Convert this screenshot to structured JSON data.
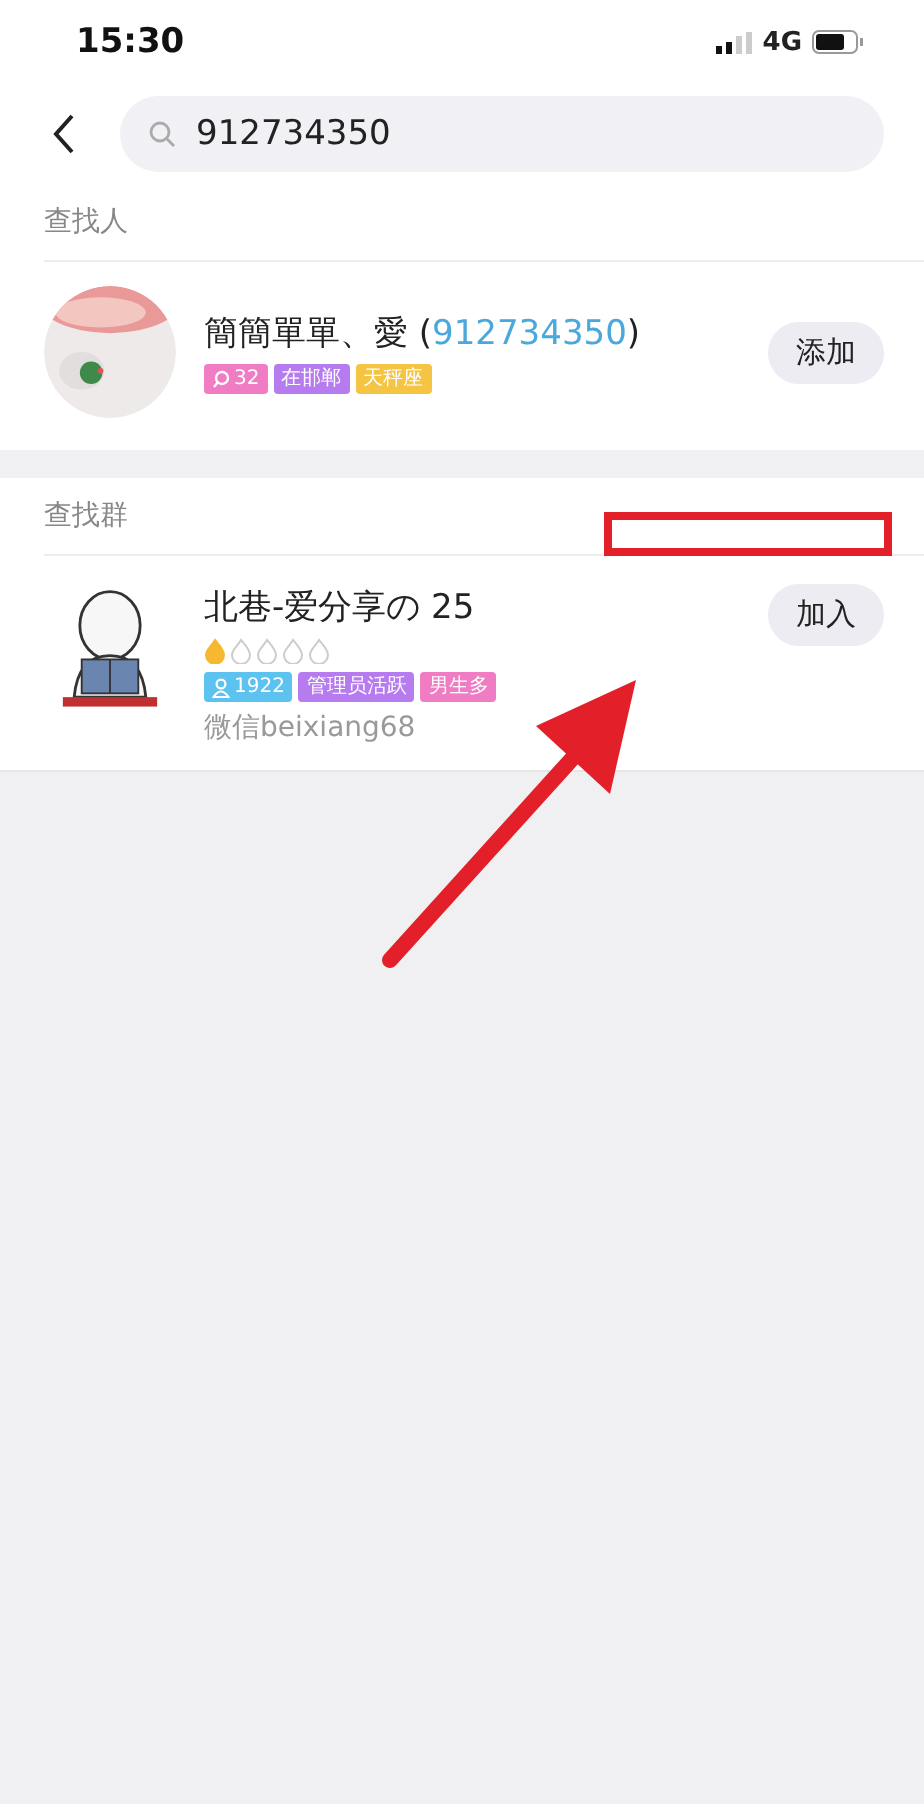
{
  "status_bar": {
    "time": "15:30",
    "network": "4G"
  },
  "search": {
    "value": "912734350"
  },
  "people_section": {
    "title": "查找人",
    "results": [
      {
        "name": "簡簡單單、愛 (",
        "id": "912734350",
        "name_end": ")",
        "button": "添加",
        "tags": [
          {
            "kind": "count",
            "text": "32",
            "color": "#f07cc4"
          },
          {
            "kind": "text",
            "text": "在邯郸",
            "color": "#b77bf0"
          },
          {
            "kind": "text",
            "text": "天秤座",
            "color": "#f5c443"
          }
        ]
      }
    ]
  },
  "groups_section": {
    "title": "查找群",
    "results": [
      {
        "name": "北巷-爱分享の 25",
        "stars": 1,
        "button": "加入",
        "tags": [
          {
            "kind": "members",
            "text": "1922",
            "color": "#5cc3f0"
          },
          {
            "kind": "text",
            "text": "管理员活跃",
            "color": "#b77bf0"
          },
          {
            "kind": "text",
            "text": "男生多",
            "color": "#f07cc4"
          }
        ],
        "subtitle": "微信beixiang68"
      }
    ]
  },
  "annotations": {
    "highlight_box": true,
    "arrow": true
  }
}
